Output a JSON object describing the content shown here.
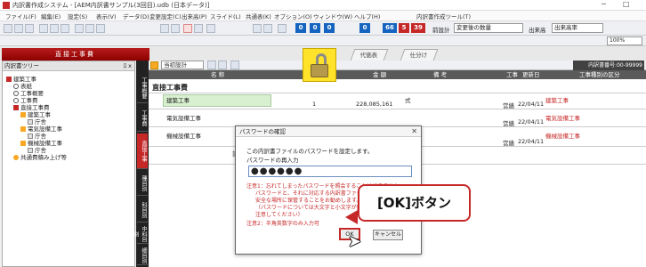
{
  "window": {
    "title": "内訳書作成システム - [AEM内訳書サンプル(3回目).udb (日本データ)]",
    "minimize_icon": "minimize-icon",
    "maximize_icon": "maximize-icon"
  },
  "menu": [
    "ファイル(F)",
    "編集(E)",
    "設定(S)",
    "表示(V)",
    "データ(D)",
    "変更設定(C)",
    "出来高(P)",
    "スライド(L)",
    "共通表(K)",
    "オプション(O)",
    "ウィンドウ(W)",
    "ヘルプ(H)",
    "内訳書作成ツール(T)"
  ],
  "toolbar": {
    "num_boxes": [
      {
        "value": "0",
        "color": "#1565c0"
      },
      {
        "value": "0",
        "color": "#1565c0"
      },
      {
        "value": "0",
        "color": "#1565c0"
      },
      {
        "value": "0",
        "color": "#1565c0"
      },
      {
        "value": "66",
        "color": "#1565c0"
      },
      {
        "value": "5",
        "color": "#c62828"
      },
      {
        "value": "39",
        "color": "#c62828"
      }
    ],
    "label_before": "前設計",
    "select_change": "変更後の数量",
    "select_display": "出来高率",
    "zoom": "100%"
  },
  "tabs": {
    "active": "直接工事費",
    "others": [
      "代価表",
      "仕分け"
    ]
  },
  "left_panel": {
    "title": "内訳書ツリー",
    "pin": "ﾛ x",
    "items": [
      {
        "label": "建築工事",
        "indent": 0
      },
      {
        "label": "表紙",
        "indent": 1
      },
      {
        "label": "工事概要",
        "indent": 1
      },
      {
        "label": "工事費",
        "indent": 1
      },
      {
        "label": "直接工事費",
        "indent": 1
      },
      {
        "label": "建築工事",
        "indent": 2
      },
      {
        "label": "庁舎",
        "indent": 3
      },
      {
        "label": "電気設備工事",
        "indent": 2
      },
      {
        "label": "庁舎",
        "indent": 3
      },
      {
        "label": "機械設備工事",
        "indent": 2
      },
      {
        "label": "庁舎",
        "indent": 3
      },
      {
        "label": "共通費積み上げ等",
        "indent": 1
      }
    ]
  },
  "vertical_tabs": [
    "工事概要",
    "工事費",
    "直接工事",
    "種目別",
    "科目別",
    "中科目別",
    "細目別"
  ],
  "main": {
    "sub_select": "当初設計",
    "doc_no": "内訳書番号:00-99999",
    "columns": [
      "名 称",
      "金 額",
      "備 考",
      "工事",
      "更新日",
      "工事種別の区分"
    ],
    "sheet_title": "直接工事費",
    "rows": [
      {
        "name": "建築工事",
        "qty": "1",
        "amount": "228,085,161",
        "remark": "式",
        "status": "営繕",
        "date": "22/04/11",
        "category": "建築工事"
      },
      {
        "name": "電気設備工事",
        "qty": "",
        "amount": "",
        "remark": "",
        "status": "営繕",
        "date": "22/04/11",
        "category": "電気設備工事"
      },
      {
        "name": "機械設備工事",
        "qty": "",
        "amount": "",
        "remark": "",
        "status": "営繕",
        "date": "22/04/11",
        "category": "機械設備工事"
      },
      {
        "name": "計",
        "qty": "",
        "amount": "",
        "remark": "",
        "status": "",
        "date": "",
        "category": ""
      }
    ]
  },
  "dialog": {
    "title": "パスワードの確認",
    "line1": "この内訳書ファイルのパスワードを設定します。",
    "line2": "パスワードの再入力",
    "password_mask": "●●●●●●",
    "note1_a": "注意1：忘れてしまったパスワードを照会することはできません。",
    "note1_b": "パスワードと、それに対応する内訳書ファイル名を一",
    "note1_c": "安全な場所に保管することをお勧めします。",
    "note1_d": "（パスワードについては大文字と小文字が区別されま",
    "note1_e": "注意してください）",
    "note2": "注意2：半角英数字のみ入力可",
    "ok": "OK",
    "cancel": "キャンセル"
  },
  "callout": "[OK]ボタン"
}
